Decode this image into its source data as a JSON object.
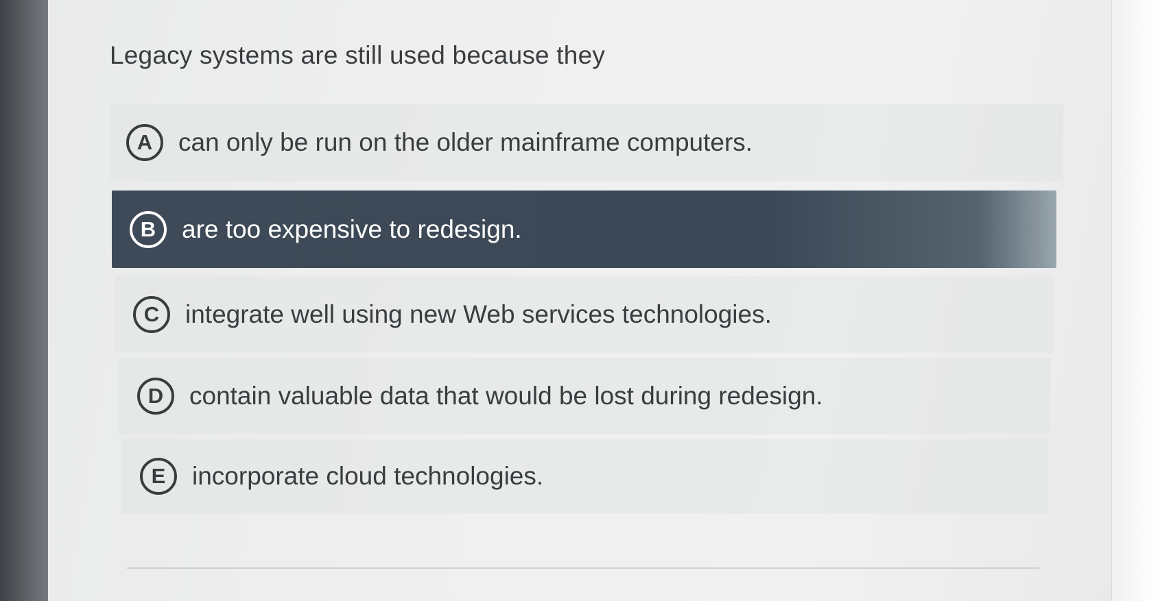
{
  "question": {
    "text": "Legacy systems are still used because they"
  },
  "options": [
    {
      "letter": "A",
      "text": "can only be run on the older mainframe computers.",
      "selected": false
    },
    {
      "letter": "B",
      "text": "are too expensive to redesign.",
      "selected": true
    },
    {
      "letter": "C",
      "text": "integrate well using new Web services technologies.",
      "selected": false
    },
    {
      "letter": "D",
      "text": "contain valuable data that would be lost during redesign.",
      "selected": false
    },
    {
      "letter": "E",
      "text": "incorporate cloud technologies.",
      "selected": false
    }
  ],
  "colors": {
    "selected_background": "#3e4a57",
    "text": "#3a3d40"
  }
}
